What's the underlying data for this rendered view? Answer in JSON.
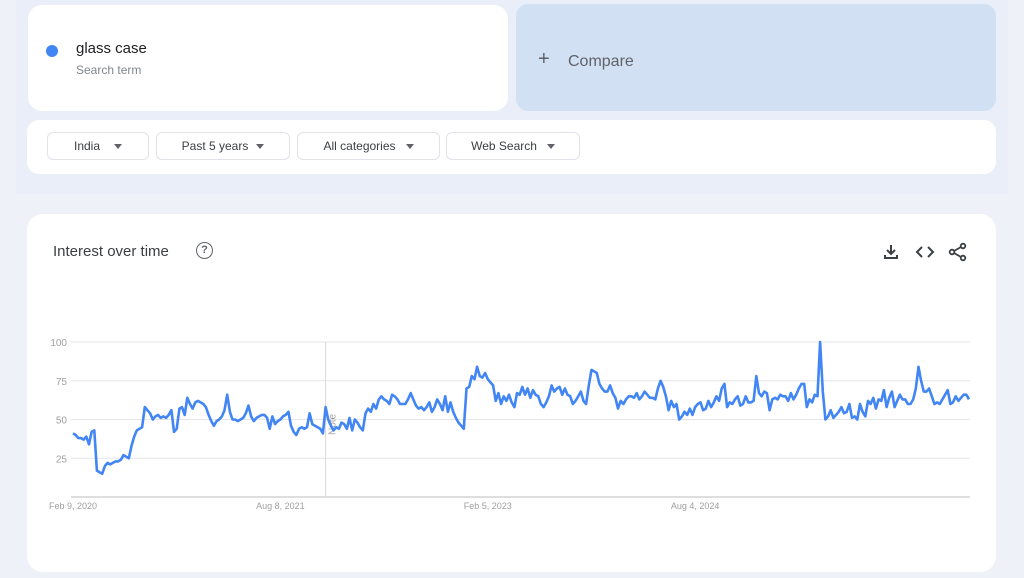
{
  "search_term": {
    "name": "glass case",
    "subtitle": "Search term",
    "color": "#4285f4"
  },
  "compare": {
    "label": "Compare",
    "icon": "plus-icon"
  },
  "filters": [
    {
      "label": "India"
    },
    {
      "label": "Past 5 years"
    },
    {
      "label": "All categories"
    },
    {
      "label": "Web Search"
    }
  ],
  "chart_card": {
    "title": "Interest over time",
    "help_icon": "help-circle-icon",
    "actions": [
      "download-icon",
      "embed-code-icon",
      "share-icon"
    ],
    "note_label": "Note"
  },
  "chart_data": {
    "type": "line",
    "title": "Interest over time",
    "xlabel": "",
    "ylabel": "",
    "ylim": [
      0,
      100
    ],
    "yticks": [
      25,
      50,
      75,
      100
    ],
    "xtick_labels": [
      "Feb 9, 2020",
      "Aug 8, 2021",
      "Feb 5, 2023",
      "Aug 4, 2024"
    ],
    "xtick_indices": [
      0,
      78,
      156,
      234
    ],
    "grid": true,
    "note_index": 95,
    "series": [
      {
        "name": "glass case",
        "color": "#4285f4",
        "values": [
          41,
          40,
          38,
          38,
          37,
          39,
          34,
          42,
          43,
          17,
          16,
          15,
          20,
          22,
          21,
          22,
          23,
          23,
          24,
          27,
          26,
          25,
          33,
          39,
          43,
          44,
          45,
          58,
          56,
          54,
          50,
          52,
          53,
          51,
          52,
          51,
          53,
          56,
          42,
          44,
          57,
          58,
          53,
          64,
          60,
          57,
          61,
          62,
          61,
          60,
          58,
          53,
          49,
          46,
          49,
          50,
          52,
          56,
          66,
          55,
          50,
          50,
          49,
          50,
          51,
          54,
          59,
          52,
          49,
          51,
          52,
          53,
          53,
          51,
          44,
          52,
          47,
          49,
          50,
          52,
          53,
          55,
          46,
          42,
          40,
          44,
          45,
          44,
          45,
          54,
          47,
          46,
          45,
          44,
          41,
          58,
          50,
          46,
          43,
          45,
          44,
          48,
          47,
          44,
          51,
          43,
          50,
          48,
          45,
          43,
          54,
          57,
          55,
          60,
          57,
          63,
          65,
          63,
          62,
          60,
          66,
          65,
          63,
          60,
          60,
          60,
          63,
          67,
          63,
          59,
          57,
          58,
          56,
          58,
          61,
          55,
          58,
          63,
          60,
          56,
          65,
          55,
          61,
          55,
          51,
          48,
          46,
          44,
          70,
          71,
          78,
          76,
          84,
          78,
          77,
          80,
          76,
          74,
          72,
          62,
          67,
          60,
          65,
          62,
          66,
          61,
          58,
          67,
          66,
          71,
          66,
          70,
          64,
          69,
          66,
          65,
          60,
          58,
          61,
          65,
          72,
          68,
          70,
          71,
          66,
          70,
          66,
          65,
          60,
          62,
          65,
          68,
          62,
          60,
          72,
          82,
          81,
          80,
          73,
          70,
          68,
          68,
          72,
          67,
          64,
          57,
          62,
          60,
          63,
          65,
          65,
          64,
          67,
          63,
          65,
          68,
          66,
          64,
          64,
          63,
          70,
          75,
          71,
          65,
          56,
          62,
          58,
          60,
          50,
          52,
          55,
          53,
          57,
          53,
          58,
          60,
          61,
          56,
          57,
          62,
          58,
          61,
          65,
          62,
          70,
          73,
          58,
          61,
          60,
          63,
          65,
          59,
          60,
          65,
          61,
          61,
          62,
          78,
          67,
          65,
          68,
          67,
          56,
          63,
          64,
          63,
          66,
          65,
          65,
          62,
          67,
          63,
          66,
          70,
          73,
          73,
          58,
          63,
          61,
          66,
          65,
          100,
          68,
          50,
          52,
          56,
          51,
          53,
          55,
          58,
          54,
          55,
          60,
          51,
          52,
          50,
          60,
          55,
          52,
          62,
          60,
          64,
          57,
          63,
          62,
          69,
          58,
          64,
          68,
          58,
          62,
          66,
          63,
          63,
          60,
          60,
          63,
          70,
          84,
          75,
          68,
          68,
          70,
          65,
          60,
          61,
          60,
          63,
          66,
          69,
          60,
          61,
          65,
          62,
          64,
          66,
          66,
          63
        ]
      }
    ]
  }
}
